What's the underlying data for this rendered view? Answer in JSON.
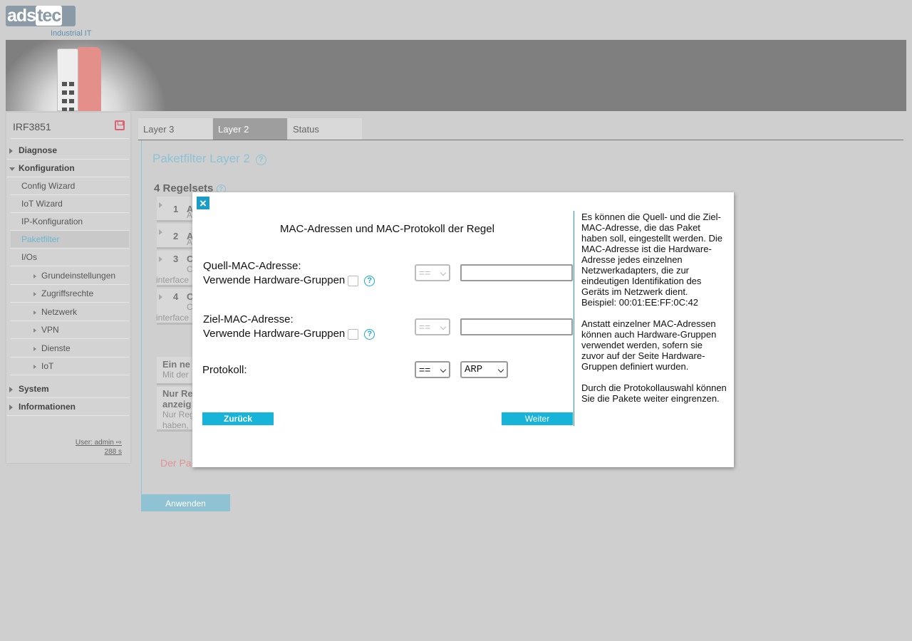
{
  "header": {
    "logo_main": "ads",
    "logo_accent": "tec",
    "logo_sub": "Industrial IT"
  },
  "sidebar": {
    "device": "IRF3851",
    "items": [
      {
        "label": "Diagnose"
      },
      {
        "label": "Konfiguration"
      },
      {
        "label": "Config Wizard"
      },
      {
        "label": "IoT Wizard"
      },
      {
        "label": "IP-Konfiguration"
      },
      {
        "label": "Paketfilter"
      },
      {
        "label": "I/Os"
      },
      {
        "label": "Grundeinstellungen"
      },
      {
        "label": "Zugriffsrechte"
      },
      {
        "label": "Netzwerk"
      },
      {
        "label": "VPN"
      },
      {
        "label": "Dienste"
      },
      {
        "label": "IoT"
      },
      {
        "label": "System"
      },
      {
        "label": "Informationen"
      }
    ],
    "user": "User: admin",
    "timer": "288 s"
  },
  "tabs": [
    {
      "label": "Layer 3"
    },
    {
      "label": "Layer 2"
    },
    {
      "label": "Status"
    }
  ],
  "main": {
    "title": "Paketfilter Layer 2",
    "regelsets": "4 Regelsets",
    "rules": [
      {
        "num": "1",
        "title": "A",
        "sub": "A",
        "iface": ""
      },
      {
        "num": "2",
        "title": "A",
        "sub": "A",
        "iface": ""
      },
      {
        "num": "3",
        "title": "C",
        "sub": "C",
        "iface": "interface"
      },
      {
        "num": "4",
        "title": "C",
        "sub": "C",
        "iface": "interface"
      }
    ],
    "info1_title": "Ein ne",
    "info1_text": "Mit der",
    "info2_title1": "Nur Re",
    "info2_title2": "anzeig",
    "info2_text1": "Nur Reg",
    "info2_text2": "haben,",
    "red_text": "Der Pa",
    "apply": "Anwenden"
  },
  "modal": {
    "close": "×",
    "title": "MAC-Adressen und MAC-Protokoll der Regel",
    "source_label": "Quell-MAC-Adresse:",
    "source_hw": "Verwende Hardware-Gruppen",
    "source_op": "==",
    "source_value": "",
    "target_label": "Ziel-MAC-Adresse:",
    "target_hw": "Verwende Hardware-Gruppen",
    "target_op": "==",
    "target_value": "",
    "protocol_label": "Protokoll:",
    "protocol_op": "==",
    "protocol_value": "ARP",
    "back": "Zurück",
    "next": "Weiter",
    "help_p1": "Es können die Quell- und die Ziel-MAC-Adresse, die das Paket haben soll, eingestellt werden. Die MAC-Adresse ist die Hardware-Adresse jedes einzelnen Netzwerkadapters, die zur eindeutigen Identifikation des Geräts im Netzwerk dient.\nBeispiel: 00:01:EE:FF:0C:42",
    "help_p2": "Anstatt einzelner MAC-Adressen können auch Hardware-Gruppen verwendet werden, sofern sie zuvor auf der Seite Hardware-Gruppen definiert wurden.",
    "help_p3": "Durch die Protokollauswahl können Sie die Pakete weiter eingrenzen."
  }
}
